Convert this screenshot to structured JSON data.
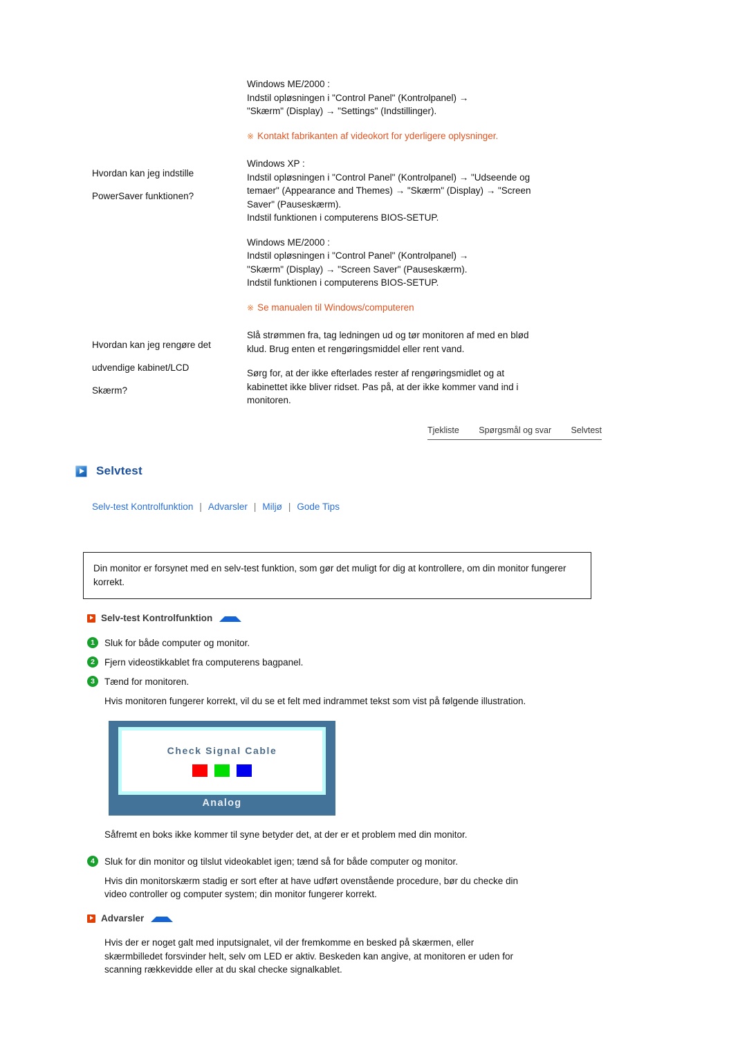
{
  "faq": {
    "rows": [
      {
        "question": "",
        "answer_lines": [
          "Windows ME/2000 :",
          "Indstil opløsningen i \"Control Panel\" (Kontrolpanel) →",
          "\"Skærm\" (Display) → \"Settings\" (Indstillinger)."
        ],
        "note": "Kontakt fabrikanten af videokort for yderligere oplysninger.",
        "note_mark": "※"
      },
      {
        "question_lines": [
          "Hvordan kan jeg indstille",
          "PowerSaver funktionen?"
        ],
        "answer_block1": [
          "Windows XP :",
          "Indstil opløsningen i \"Control Panel\" (Kontrolpanel) → \"Udseende og",
          "temaer\" (Appearance and Themes) → \"Skærm\" (Display) → \"Screen",
          "Saver\" (Pauseskærm).",
          "Indstil funktionen i computerens BIOS-SETUP."
        ],
        "answer_block2": [
          "Windows ME/2000 :",
          "Indstil opløsningen i \"Control Panel\" (Kontrolpanel) →",
          "\"Skærm\" (Display) → \"Screen Saver\" (Pauseskærm).",
          "Indstil funktionen i computerens BIOS-SETUP."
        ],
        "note": "Se manualen til Windows/computeren",
        "note_mark": "※"
      },
      {
        "question_lines": [
          "Hvordan kan jeg rengøre det",
          "udvendige kabinet/LCD",
          "Skærm?"
        ],
        "answer_block1": [
          "Slå strømmen fra, tag ledningen ud og tør monitoren af med en blød",
          "klud. Brug enten et rengøringsmiddel eller rent vand."
        ],
        "answer_block2": [
          "Sørg for, at der ikke efterlades rester af rengøringsmidlet og at",
          "kabinettet ikke bliver ridset. Pas på, at der ikke kommer vand ind i",
          "monitoren."
        ]
      }
    ]
  },
  "breadcrumb": {
    "items": [
      "Tjekliste",
      "Spørgsmål og svar",
      "Selvtest"
    ]
  },
  "section": {
    "title": "Selvtest",
    "icon": "blue-play-square-icon"
  },
  "subnav": {
    "links": [
      "Selv-test Kontrolfunktion",
      "Advarsler",
      "Miljø",
      "Gode Tips"
    ],
    "separator": "|"
  },
  "intro": {
    "text": "Din monitor er forsynet med en selv-test funktion, som gør det muligt for dig at kontrollere, om din monitor fungerer korrekt."
  },
  "selftest": {
    "heading": "Selv-test Kontrolfunktion",
    "steps": [
      {
        "num": "1",
        "text": "Sluk for både computer og monitor."
      },
      {
        "num": "2",
        "text": "Fjern videostikkablet fra computerens bagpanel."
      },
      {
        "num": "3",
        "text": "Tænd for monitoren."
      }
    ],
    "after_steps": "Hvis monitoren fungerer korrekt, vil du se et felt med indrammet tekst som vist på følgende illustration.",
    "after_monitor": "Såfremt en boks ikke kommer til syne betyder det, at der er et problem med din monitor.",
    "step4": {
      "num": "4",
      "text": "Sluk for din monitor og tilslut videokablet igen; tænd så for både computer og monitor."
    },
    "step4_note_lines": [
      "Hvis din monitorskærm stadig er sort efter at have udført ovenstående procedure, bør du checke din",
      "video controller og computer system; din monitor fungerer korrekt."
    ]
  },
  "monitor_illustration": {
    "message": "Check Signal Cable",
    "label": "Analog",
    "frame_color": "#437399",
    "inner_border_color": "#bdfcfb",
    "swatches": [
      {
        "name": "red",
        "color": "#FF0000"
      },
      {
        "name": "green",
        "color": "#00DD00"
      },
      {
        "name": "blue",
        "color": "#0000EE"
      }
    ]
  },
  "advarsler": {
    "heading": "Advarsler",
    "body_lines": [
      "Hvis der er noget galt med inputsignalet, vil der fremkomme en besked på skærmen, eller",
      "skærmbilledet forsvinder helt, selv om LED er aktiv. Beskeden kan angive, at monitoren er uden for",
      "scanning rækkevidde eller at du skal checke signalkablet."
    ]
  },
  "colors": {
    "note_orange": "#E2521F",
    "link_blue": "#2a6fd6",
    "heading_blue": "#1B4F9C",
    "step_green": "#18A02C"
  }
}
